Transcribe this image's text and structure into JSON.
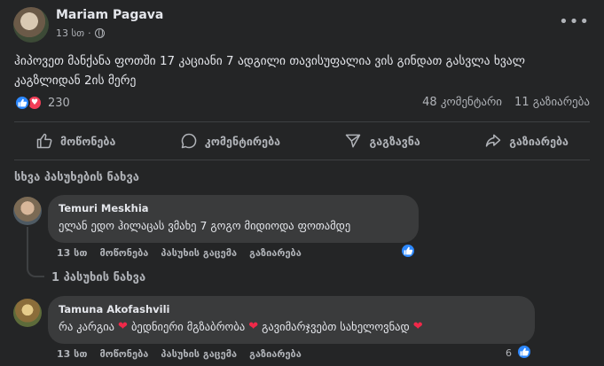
{
  "post": {
    "author": "Mariam Pagava",
    "time": "13 სთ",
    "separator": "·",
    "text": "ჰიპოვეთ მანქანა ფოთში 17 კაციანი  7 ადგილი თავისუფალია ვის გინდათ გასვლა ხვალ კაგზლიდან 2ის მერე",
    "reaction_count": "230",
    "comments_count": "48 კომენტარი",
    "shares_count": "11 გაზიარება"
  },
  "actions": {
    "like": "მოწონება",
    "comment": "კომენტირება",
    "send": "გაგზავნა",
    "share": "გაზიარება"
  },
  "see_more": "სხვა პასუხების ნახვა",
  "comments": [
    {
      "name": "Temuri Meskhia",
      "text": "ელან ედო ჰილაცას ვმახე 7 გოგო მიდიოდა ფოთამდე",
      "time": "13 სთ",
      "like": "მოწონება",
      "reply": "პასუხის გაცემა",
      "share": "გაზიარება",
      "replies_link": "1 პასუხის ნახვა"
    },
    {
      "name": "Tamuna Akofashvili",
      "text_parts": [
        "რა კარგია",
        "ბედნიერი მგზაბრობა",
        "გავიმარჯვებთ სახელოვნად"
      ],
      "time": "13 სთ",
      "like": "მოწონება",
      "reply": "პასუხის გაცემა",
      "share": "გაზიარება",
      "like_count": "6"
    }
  ],
  "colors": {
    "background": "#242526",
    "bubble": "#3a3b3c",
    "like_blue": "#2d88ff",
    "love_red": "#f33e58"
  },
  "icons": {
    "more": "more-icon",
    "privacy": "globe-icon",
    "like": "thumbs-up-icon",
    "comment": "comment-icon",
    "send": "send-icon",
    "share": "share-icon",
    "love": "heart-icon"
  }
}
